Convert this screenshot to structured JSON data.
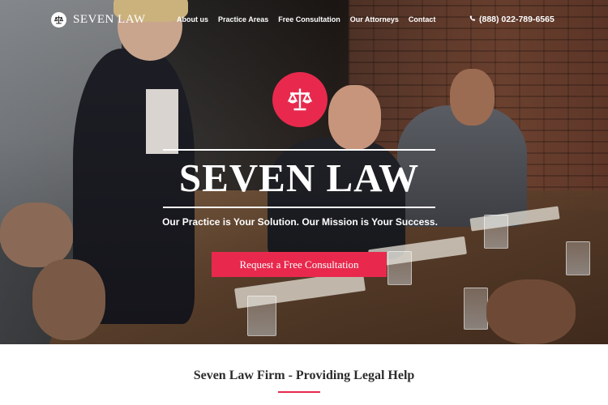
{
  "brand": {
    "name": "SEVEN LAW",
    "logo_icon": "scales-icon"
  },
  "nav": {
    "items": [
      "About us",
      "Practice Areas",
      "Free Consultation",
      "Our Attorneys",
      "Contact"
    ],
    "phone": "(888) 022-789-6565",
    "phone_icon": "phone-icon"
  },
  "hero": {
    "emblem_icon": "scales-icon",
    "title": "SEVEN LAW",
    "tagline": "Our Practice is Your Solution. Our Mission is Your Success.",
    "cta_label": "Request a Free Consultation"
  },
  "section": {
    "title": "Seven Law Firm - Providing Legal Help"
  },
  "colors": {
    "accent": "#e8294d",
    "text_dark": "#2b2b2b",
    "white": "#ffffff"
  }
}
